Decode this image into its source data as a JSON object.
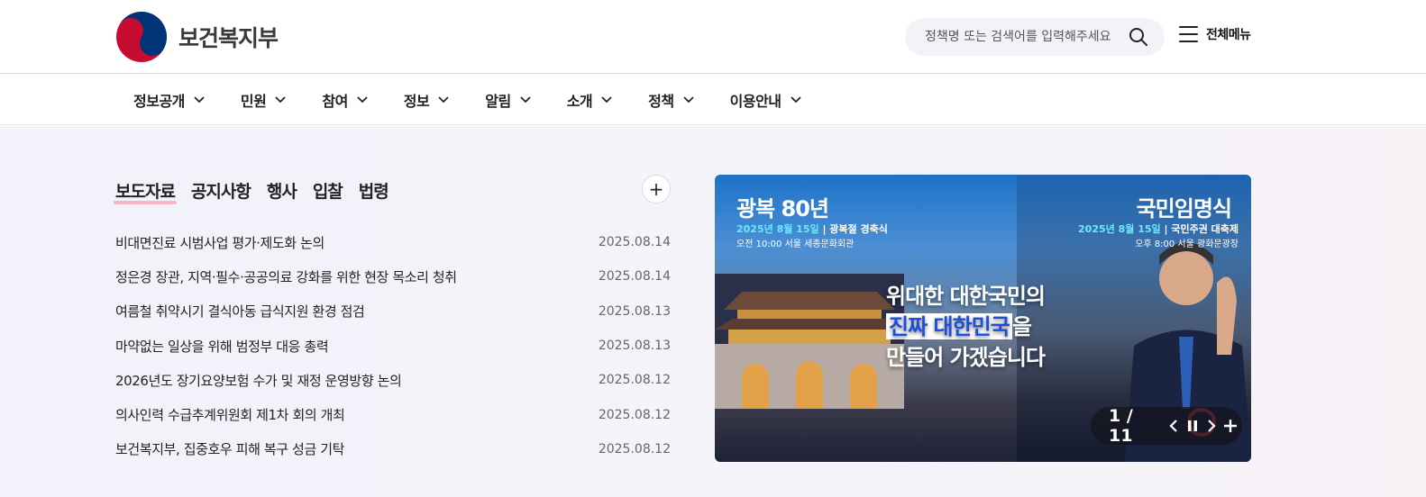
{
  "header": {
    "logo_text": "보건복지부",
    "search_placeholder": "정책명 또는 검색어를 입력해주세요",
    "all_menu_label": "전체메뉴"
  },
  "gnb": {
    "items": [
      "정보공개",
      "민원",
      "참여",
      "정보",
      "알림",
      "소개",
      "정책",
      "이용안내"
    ]
  },
  "news": {
    "tabs": [
      "보도자료",
      "공지사항",
      "행사",
      "입찰",
      "법령"
    ],
    "active_tab": "보도자료",
    "more_label": "+",
    "rows": [
      {
        "title": "비대면진료 시범사업 평가·제도화 논의",
        "date": "2025.08.14"
      },
      {
        "title": "정은경 장관, 지역·필수·공공의료 강화를 위한 현장 목소리 청취",
        "date": "2025.08.14"
      },
      {
        "title": "여름철 취약시기 결식아동 급식지원 환경 점검",
        "date": "2025.08.13"
      },
      {
        "title": "마약없는 일상을 위해 범정부 대응 총력",
        "date": "2025.08.13"
      },
      {
        "title": "2026년도 장기요양보험 수가 및 재정 운영방향 논의",
        "date": "2025.08.12"
      },
      {
        "title": "의사인력 수급추계위원회 제1차 회의 개최",
        "date": "2025.08.12"
      },
      {
        "title": "보건복지부, 집중호우 피해 복구 성금 기탁",
        "date": "2025.08.12"
      }
    ]
  },
  "banner": {
    "left_title": "광복 80년",
    "left_date": "2025년 8월 15일",
    "left_event": "광복절 경축식",
    "left_place": "오전 10:00 서울 세종문화회관",
    "right_title": "국민임명식",
    "right_date": "2025년 8월 15일",
    "right_event": "국민주권 대축제",
    "right_place": "오후 8:00 서울 광화문광장",
    "slogan_line1": "위대한 대한국민의",
    "slogan_boxed": "진짜 대한민국",
    "slogan_line2_suffix": "을",
    "slogan_line3": "만들어 가겠습니다",
    "counter": "1 / 11"
  }
}
